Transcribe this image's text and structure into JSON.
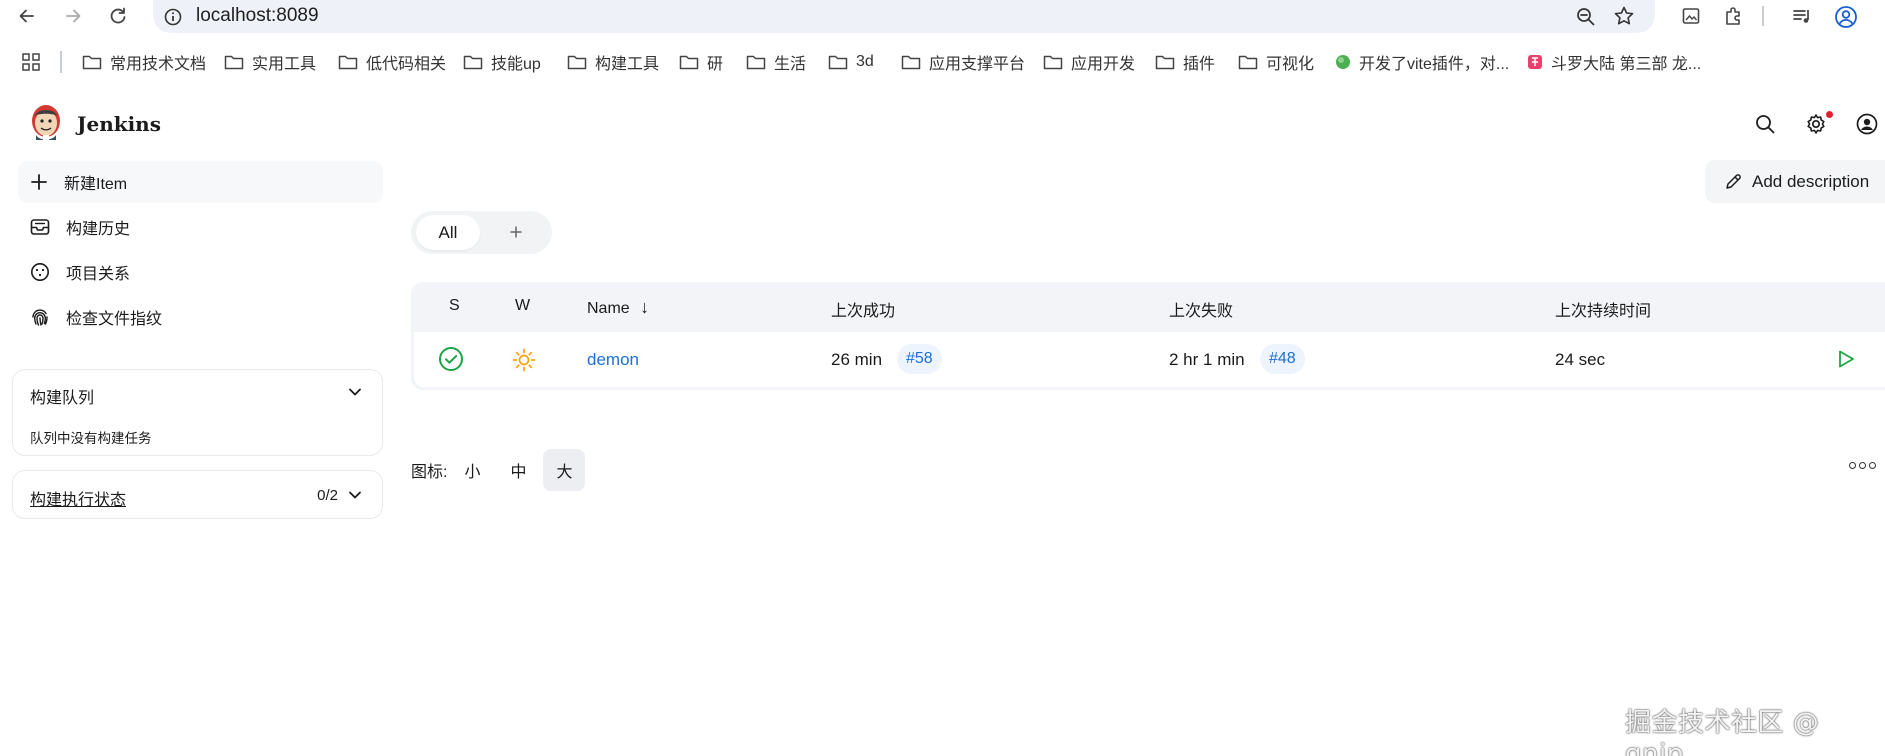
{
  "browser": {
    "url": "localhost:8089",
    "bookmarks": [
      {
        "label": "常用技术文档",
        "icon": "folder-icon"
      },
      {
        "label": "实用工具",
        "icon": "folder-icon"
      },
      {
        "label": "低代码相关",
        "icon": "folder-icon"
      },
      {
        "label": "技能up",
        "icon": "folder-icon"
      },
      {
        "label": "构建工具",
        "icon": "folder-icon"
      },
      {
        "label": "研",
        "icon": "folder-icon"
      },
      {
        "label": "生活",
        "icon": "folder-icon"
      },
      {
        "label": "3d",
        "icon": "folder-icon"
      },
      {
        "label": "应用支撑平台",
        "icon": "folder-icon"
      },
      {
        "label": "应用开发",
        "icon": "folder-icon"
      },
      {
        "label": "插件",
        "icon": "folder-icon"
      },
      {
        "label": "可视化",
        "icon": "folder-icon"
      },
      {
        "label": "开发了vite插件，对...",
        "icon": "site-favicon-green"
      },
      {
        "label": "斗罗大陆 第三部 龙...",
        "icon": "site-favicon-red"
      }
    ]
  },
  "header": {
    "brand": "Jenkins"
  },
  "sidebar": {
    "items": [
      {
        "label": "新建Item",
        "icon": "plus-icon"
      },
      {
        "label": "构建历史",
        "icon": "inbox-icon"
      },
      {
        "label": "项目关系",
        "icon": "relations-icon"
      },
      {
        "label": "检查文件指纹",
        "icon": "fingerprint-icon"
      }
    ],
    "queue": {
      "title": "构建队列",
      "empty_text": "队列中没有构建任务"
    },
    "executors": {
      "title": "构建执行状态",
      "count": "0/2"
    }
  },
  "main": {
    "add_description": "Add description",
    "tabs": [
      {
        "label": "All"
      }
    ],
    "table": {
      "headers": {
        "s": "S",
        "w": "W",
        "name": "Name",
        "sort_arrow": "↓",
        "last_success": "上次成功",
        "last_failure": "上次失败",
        "last_duration": "上次持续时间"
      },
      "rows": [
        {
          "status": "success",
          "weather": "sunny",
          "name": "demon",
          "last_success": "26 min",
          "last_success_build": "#58",
          "last_failure": "2 hr 1 min",
          "last_failure_build": "#48",
          "last_duration": "24 sec"
        }
      ]
    },
    "icon_size": {
      "label": "图标:",
      "small": "小",
      "medium": "中",
      "large": "大",
      "selected": "大"
    }
  },
  "watermark": "掘金技术社区 @ gnip",
  "colors": {
    "link": "#1c6fd6",
    "success": "#1ea446",
    "sunny": "#f0a30a",
    "notification": "#e5202e"
  }
}
